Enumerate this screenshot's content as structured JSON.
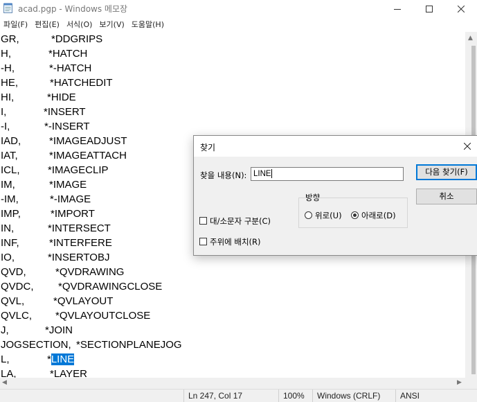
{
  "window": {
    "title": "acad.pgp - Windows 메모장",
    "icon": "notepad-icon"
  },
  "menu": [
    "파일(F)",
    "편집(E)",
    "서식(O)",
    "보기(V)",
    "도움말(H)"
  ],
  "editor": {
    "lines": [
      {
        "alias": "GR,",
        "cmd": "*DDGRIPS"
      },
      {
        "alias": "H,",
        "cmd": "*HATCH"
      },
      {
        "alias": "-H,",
        "cmd": "*-HATCH"
      },
      {
        "alias": "HE,",
        "cmd": "*HATCHEDIT"
      },
      {
        "alias": "HI,",
        "cmd": "*HIDE"
      },
      {
        "alias": "I,",
        "cmd": "*INSERT"
      },
      {
        "alias": "-I,",
        "cmd": "*-INSERT"
      },
      {
        "alias": "IAD,",
        "cmd": "*IMAGEADJUST"
      },
      {
        "alias": "IAT,",
        "cmd": "*IMAGEATTACH"
      },
      {
        "alias": "ICL,",
        "cmd": "*IMAGECLIP"
      },
      {
        "alias": "IM,",
        "cmd": "*IMAGE"
      },
      {
        "alias": "-IM,",
        "cmd": "*-IMAGE"
      },
      {
        "alias": "IMP,",
        "cmd": "*IMPORT"
      },
      {
        "alias": "IN,",
        "cmd": "*INTERSECT"
      },
      {
        "alias": "INF,",
        "cmd": "*INTERFERE"
      },
      {
        "alias": "IO,",
        "cmd": "*INSERTOBJ"
      },
      {
        "alias": "QVD,",
        "cmd": "*QVDRAWING"
      },
      {
        "alias": "QVDC,",
        "cmd": "*QVDRAWINGCLOSE"
      },
      {
        "alias": "QVL,",
        "cmd": "*QVLAYOUT"
      },
      {
        "alias": "QVLC,",
        "cmd": "*QVLAYOUTCLOSE"
      },
      {
        "alias": "J,",
        "cmd": "*JOIN"
      },
      {
        "alias": "JOGSECTION,",
        "cmd": "*SECTIONPLANEJOG"
      },
      {
        "alias": "L,",
        "cmd_prefix": "*",
        "cmd_highlight": "LINE"
      },
      {
        "alias": "LA,",
        "cmd": "*LAYER"
      }
    ]
  },
  "status": {
    "position": "Ln 247, Col 17",
    "zoom": "100%",
    "line_ending": "Windows (CRLF)",
    "encoding": "ANSI"
  },
  "find_dialog": {
    "title": "찾기",
    "find_label": "찾을 내용(N):",
    "find_value": "LINE",
    "find_next_label": "다음 찾기(F)",
    "cancel_label": "취소",
    "direction_label": "방향",
    "up_label": "위로(U)",
    "down_label": "아래로(D)",
    "direction_selected": "down",
    "match_case_label": "대/소문자 구분(C)",
    "match_case_checked": false,
    "wrap_label": "주위에 배치(R)",
    "wrap_checked": false
  },
  "colors": {
    "selection": "#0078d7",
    "primary_button_border": "#0078d7"
  }
}
